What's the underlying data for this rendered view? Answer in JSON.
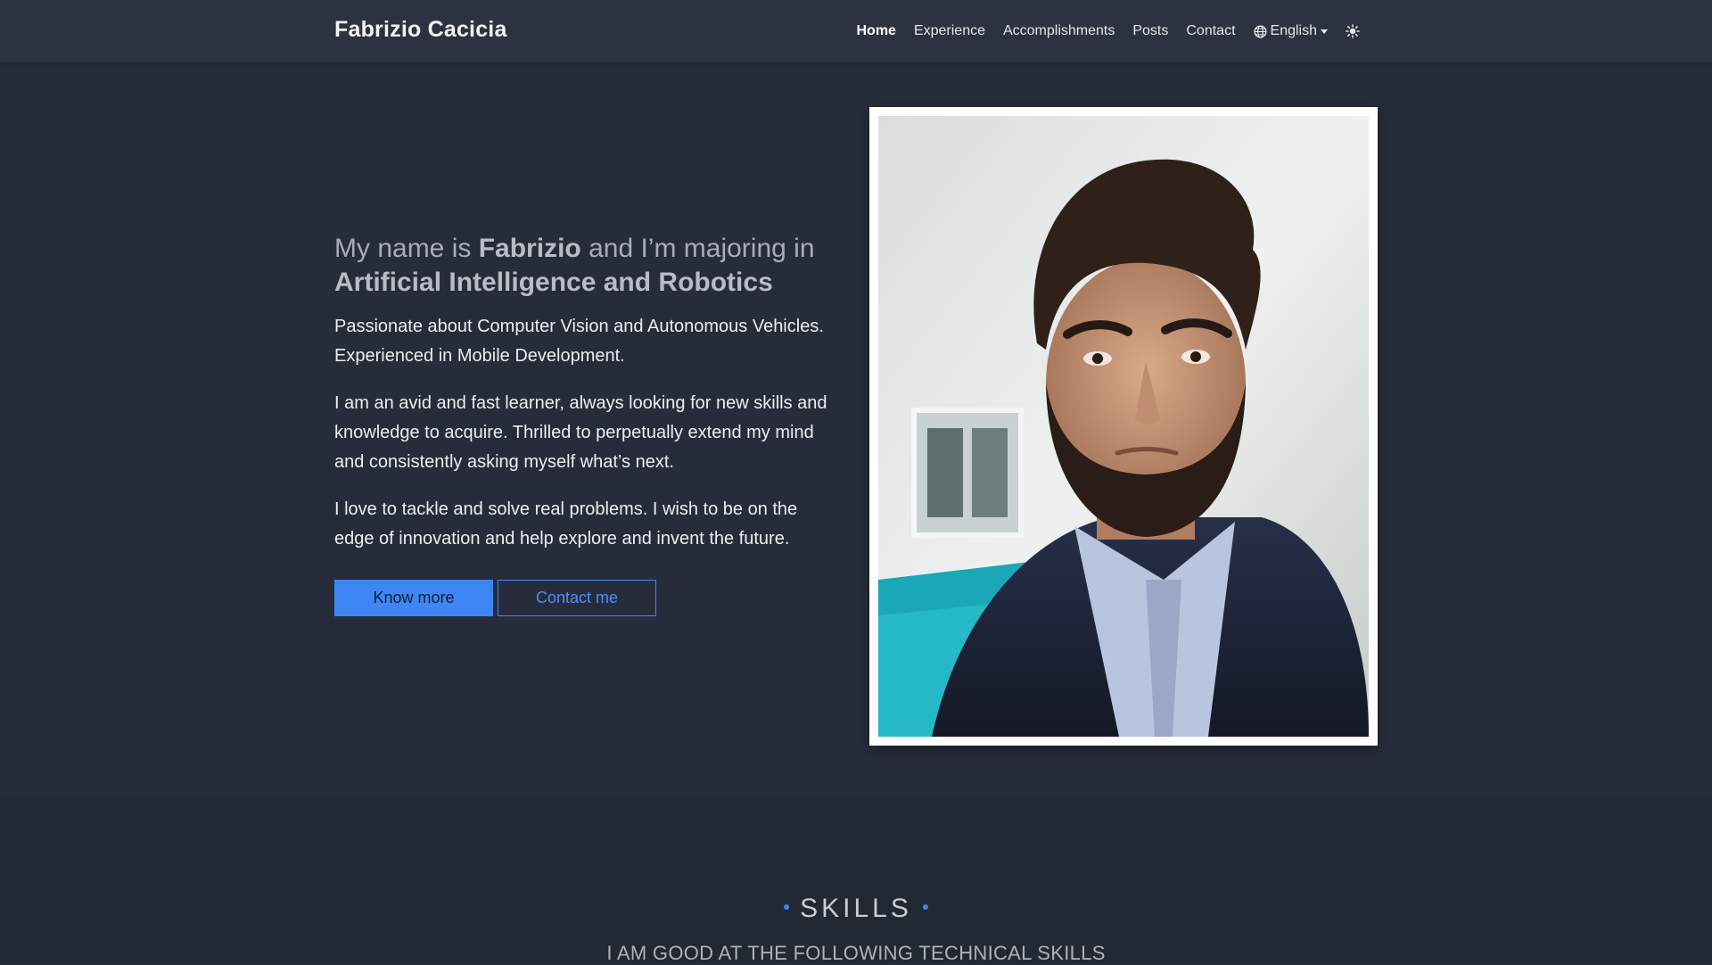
{
  "navbar": {
    "brand": "Fabrizio Cacicia",
    "items": [
      {
        "label": "Home",
        "active": true
      },
      {
        "label": "Experience"
      },
      {
        "label": "Accomplishments"
      },
      {
        "label": "Posts"
      },
      {
        "label": "Contact"
      }
    ],
    "language": "English",
    "theme_icon": "sun-icon",
    "language_icon": "globe-icon"
  },
  "hero": {
    "headline_prefix": "My name is ",
    "headline_name": "Fabrizio",
    "headline_middle": " and I’m majoring in",
    "headline_major": "Artificial Intelligence and Robotics",
    "paragraphs": [
      "Passionate about Computer Vision and Autonomous Vehicles. Experienced in Mobile Development.",
      "I am an avid and fast learner, always looking for new skills and knowledge to acquire. Thrilled to perpetually extend my mind and consistently asking myself what’s next.",
      "I love to tackle and solve real problems. I wish to be on the edge of innovation and help explore and invent the future."
    ],
    "buttons": {
      "primary": "Know more",
      "secondary": "Contact me"
    }
  },
  "skills": {
    "title": "SKILLS",
    "subtitle": "I AM GOOD AT THE FOLLOWING TECHNICAL SKILLS"
  },
  "colors": {
    "background": "#272c3a",
    "navbar": "#2d3240",
    "accent": "#3e86f6",
    "skills_background": "#232835"
  }
}
